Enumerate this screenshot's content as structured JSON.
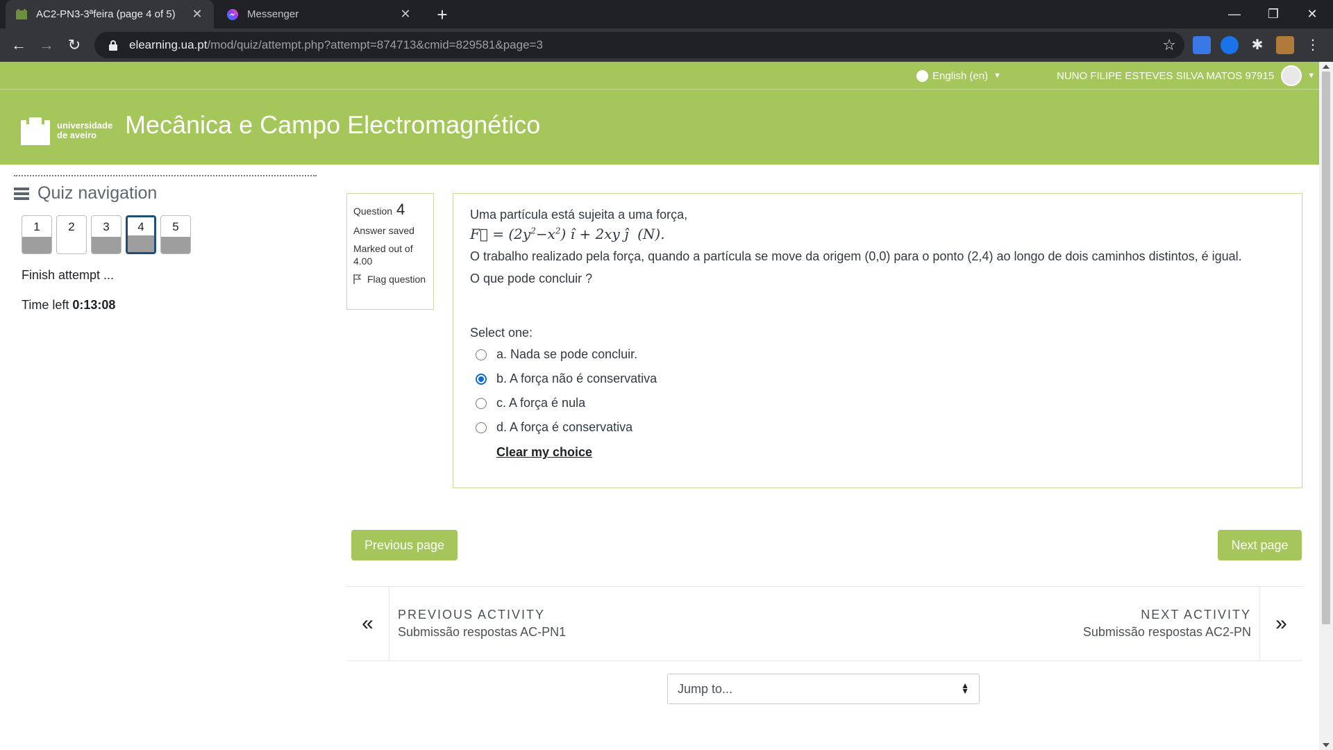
{
  "browser": {
    "tabs": [
      {
        "title": "AC2-PN3-3ªfeira (page 4 of 5)",
        "active": true
      },
      {
        "title": "Messenger",
        "active": false
      }
    ],
    "url_host": "elearning.ua.pt",
    "url_path": "/mod/quiz/attempt.php?attempt=874713&cmid=829581&page=3"
  },
  "header": {
    "language": "English (en)",
    "user_name": "NUNO FILIPE ESTEVES SILVA MATOS 97915",
    "course_title": "Mecânica e Campo Electromagnético",
    "logo_text_line1": "universidade",
    "logo_text_line2": "de aveiro"
  },
  "quiz_nav": {
    "title": "Quiz navigation",
    "questions": [
      {
        "number": "1",
        "answered": true,
        "current": false
      },
      {
        "number": "2",
        "answered": false,
        "current": false
      },
      {
        "number": "3",
        "answered": true,
        "current": false
      },
      {
        "number": "4",
        "answered": true,
        "current": true
      },
      {
        "number": "5",
        "answered": true,
        "current": false
      }
    ],
    "finish_label": "Finish attempt ...",
    "time_left_label": "Time left",
    "time_left_value": "0:13:08"
  },
  "question_info": {
    "label": "Question",
    "number": "4",
    "status": "Answer saved",
    "marked_out_of": "Marked out of 4.00",
    "flag_label": "Flag question"
  },
  "question": {
    "intro": "Uma partícula está sujeita a uma força,",
    "formula_unit": "(N).",
    "body": "O trabalho realizado pela força, quando a partícula se move da origem (0,0) para o ponto (2,4) ao longo de dois caminhos distintos, é igual.",
    "prompt": "O que pode concluir ?",
    "select_one": "Select one:",
    "options": [
      {
        "label": "a. Nada se pode concluir.",
        "selected": false
      },
      {
        "label": "b. A força não é conservativa",
        "selected": true
      },
      {
        "label": "c. A força é nula",
        "selected": false
      },
      {
        "label": "d. A força é conservativa",
        "selected": false
      }
    ],
    "clear_label": "Clear my choice"
  },
  "buttons": {
    "previous_page": "Previous page",
    "next_page": "Next page"
  },
  "activity_nav": {
    "prev_label": "PREVIOUS ACTIVITY",
    "prev_name": "Submissão respostas AC-PN1",
    "next_label": "NEXT ACTIVITY",
    "next_name": "Submissão respostas AC2-PN"
  },
  "jump_to": {
    "value": "Jump to..."
  },
  "colors": {
    "brand_green": "#a4c65b",
    "radio_selected": "#0b6bd3"
  }
}
